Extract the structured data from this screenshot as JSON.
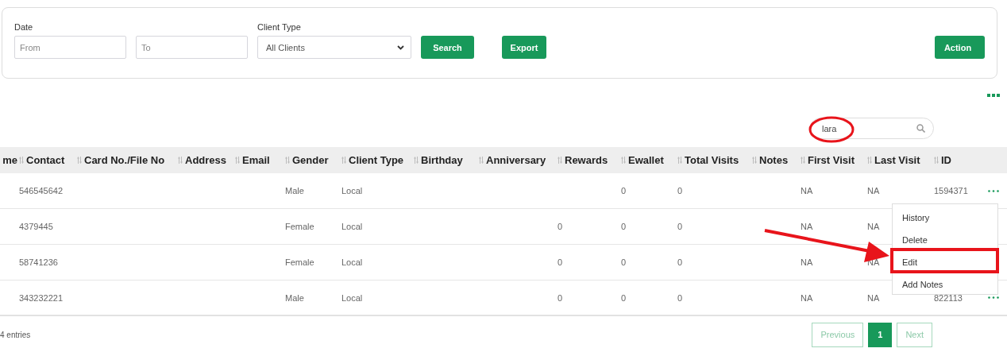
{
  "filters": {
    "date_label": "Date",
    "from": {
      "placeholder": "From"
    },
    "to": {
      "placeholder": "To"
    },
    "client_type_label": "Client Type",
    "client_type": {
      "value": "All Clients"
    },
    "buttons": [
      "Search",
      "Export"
    ],
    "action_button": "Action"
  },
  "search": {
    "value": "lara"
  },
  "table": {
    "columns": [
      "me",
      "Contact",
      "Card No./File No",
      "Address",
      "Email",
      "Gender",
      "Client Type",
      "Birthday",
      "Anniversary",
      "Rewards",
      "Ewallet",
      "Total Visits",
      "Notes",
      "First Visit",
      "Last Visit",
      "ID"
    ],
    "rows": [
      {
        "contact": "546545642",
        "gender": "Male",
        "client_type": "Local",
        "ewallet": "0",
        "total_visits": "0",
        "first_visit": "NA",
        "last_visit": "NA",
        "id": "1594371"
      },
      {
        "contact": "4379445",
        "gender": "Female",
        "client_type": "Local",
        "rewards": "0",
        "ewallet": "0",
        "total_visits": "0",
        "first_visit": "NA",
        "last_visit": "NA"
      },
      {
        "contact": "58741236",
        "gender": "Female",
        "client_type": "Local",
        "rewards": "0",
        "ewallet": "0",
        "total_visits": "0",
        "first_visit": "NA",
        "last_visit": "NA"
      },
      {
        "contact": "343232221",
        "gender": "Male",
        "client_type": "Local",
        "rewards": "0",
        "ewallet": "0",
        "total_visits": "0",
        "first_visit": "NA",
        "last_visit": "NA",
        "id": "822113"
      }
    ]
  },
  "row_menu": {
    "open": true,
    "items": [
      "History",
      "Delete",
      "Edit",
      "Add Notes"
    ]
  },
  "footer": {
    "info": "4 entries",
    "pagination": [
      {
        "label": "Previous",
        "disabled": true,
        "selected": false
      },
      {
        "label": "1",
        "disabled": false,
        "selected": true
      },
      {
        "label": "Next",
        "disabled": true,
        "selected": false
      }
    ]
  },
  "annotations": [
    {
      "kind": "circle"
    },
    {
      "kind": "arrow"
    },
    {
      "kind": "box"
    }
  ]
}
